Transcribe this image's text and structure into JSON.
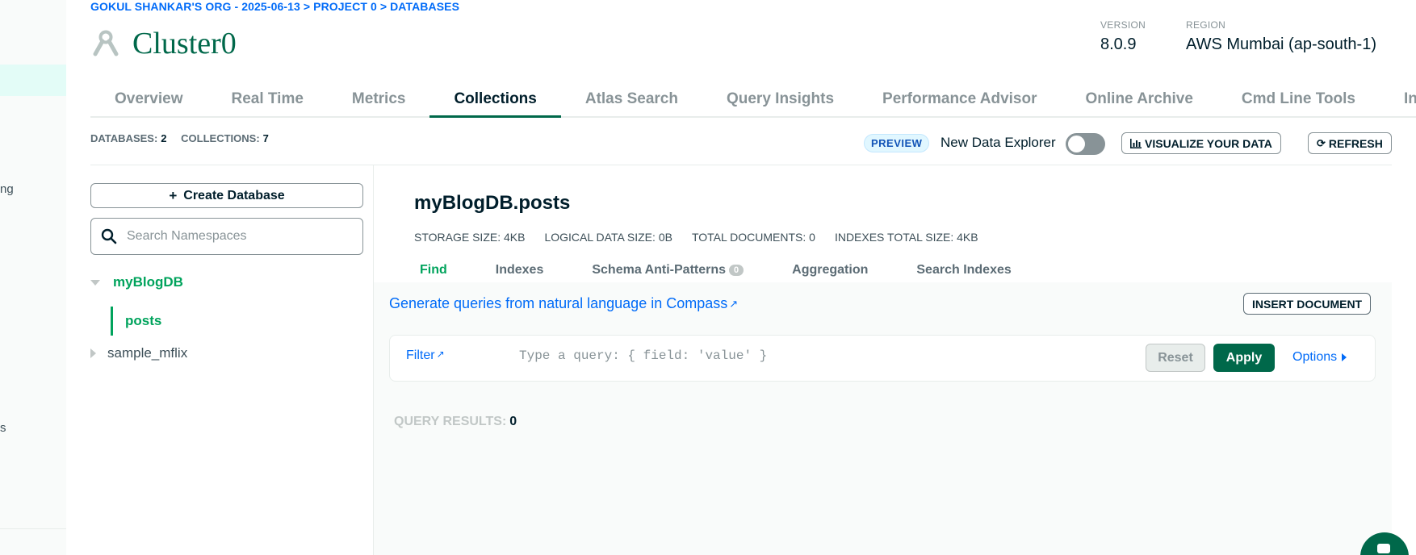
{
  "breadcrumb": "GOKUL SHANKAR'S ORG - 2025-06-13 > PROJECT 0 > DATABASES",
  "cluster": {
    "name": "Cluster0",
    "icon": "cluster-icon"
  },
  "meta": {
    "version_label": "VERSION",
    "version_value": "8.0.9",
    "region_label": "REGION",
    "region_value": "AWS Mumbai (ap-south-1)"
  },
  "leftnav": {
    "fragments": [
      "ng",
      "s"
    ]
  },
  "tabs": [
    {
      "label": "Overview"
    },
    {
      "label": "Real Time"
    },
    {
      "label": "Metrics"
    },
    {
      "label": "Collections",
      "active": true
    },
    {
      "label": "Atlas Search"
    },
    {
      "label": "Query Insights"
    },
    {
      "label": "Performance Advisor"
    },
    {
      "label": "Online Archive"
    },
    {
      "label": "Cmd Line Tools"
    },
    {
      "label": "Infr"
    }
  ],
  "stats": {
    "databases_label": "DATABASES:",
    "databases_value": "2",
    "collections_label": "COLLECTIONS:",
    "collections_value": "7"
  },
  "toolbar": {
    "preview_badge": "PREVIEW",
    "new_data_explorer_label": "New Data Explorer",
    "new_data_explorer_enabled": false,
    "visualize_label": "VISUALIZE YOUR DATA",
    "refresh_label": "REFRESH"
  },
  "sidebar": {
    "create_database_label": "Create Database",
    "search_placeholder": "Search Namespaces",
    "databases": [
      {
        "name": "myBlogDB",
        "expanded": true,
        "collections": [
          "posts"
        ]
      },
      {
        "name": "sample_mflix",
        "expanded": false
      }
    ]
  },
  "collection": {
    "title": "myBlogDB.posts",
    "storage_size_label": "STORAGE SIZE:",
    "storage_size_value": "4KB",
    "logical_size_label": "LOGICAL DATA SIZE:",
    "logical_size_value": "0B",
    "total_docs_label": "TOTAL DOCUMENTS:",
    "total_docs_value": "0",
    "indexes_size_label": "INDEXES TOTAL SIZE:",
    "indexes_size_value": "4KB"
  },
  "subtabs": [
    {
      "label": "Find",
      "active": true
    },
    {
      "label": "Indexes"
    },
    {
      "label": "Schema Anti-Patterns",
      "badge": "0"
    },
    {
      "label": "Aggregation"
    },
    {
      "label": "Search Indexes"
    }
  ],
  "find": {
    "compass_link": "Generate queries from natural language in Compass",
    "insert_document_label": "INSERT DOCUMENT",
    "filter_label": "Filter",
    "query_placeholder": "Type a query: { field: 'value' }",
    "reset_label": "Reset",
    "apply_label": "Apply",
    "options_label": "Options",
    "results_label": "QUERY RESULTS:",
    "results_value": "0"
  },
  "colors": {
    "brand_green": "#00684a",
    "accent_green": "#00a35c",
    "link_blue": "#016bf8"
  }
}
